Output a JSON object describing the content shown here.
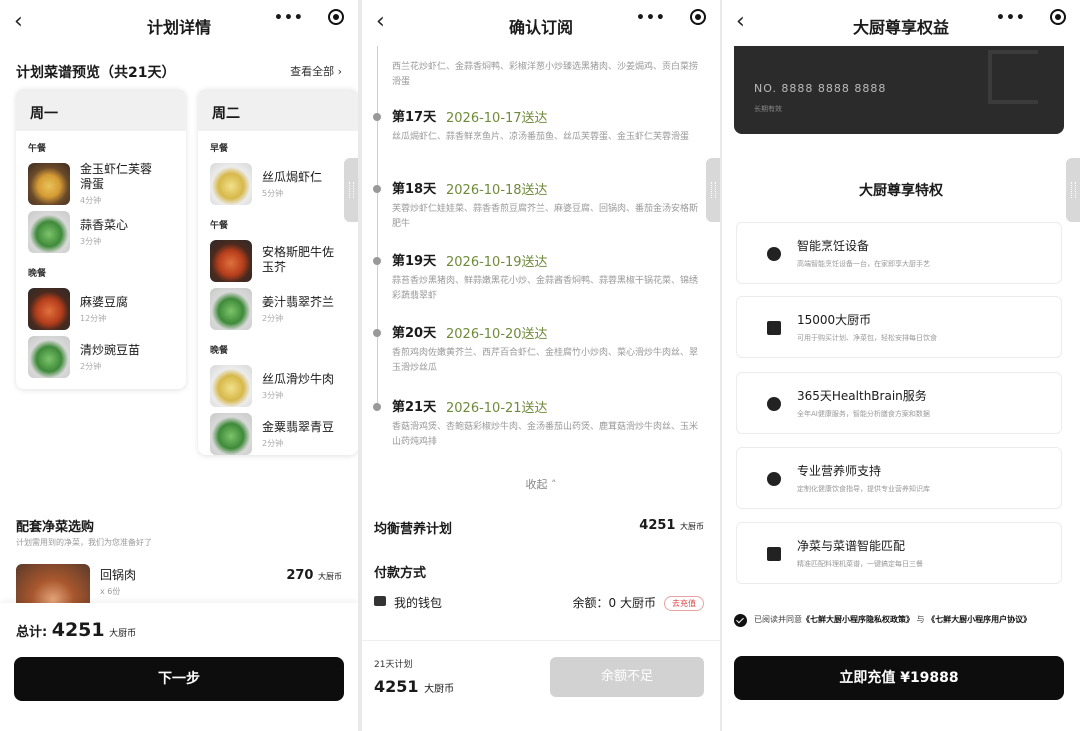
{
  "screen1": {
    "title": "计划详情",
    "section_title": "计划菜谱预览（共21天）",
    "see_all": "查看全部",
    "days": [
      {
        "name": "周一",
        "meals": [
          {
            "meal": "午餐",
            "dishes": [
              {
                "name": "金玉虾仁芙蓉\n滑蛋",
                "time": "4分钟"
              },
              {
                "name": "蒜香菜心",
                "time": "3分钟"
              }
            ]
          },
          {
            "meal": "晚餐",
            "dishes": [
              {
                "name": "麻婆豆腐",
                "time": "12分钟"
              },
              {
                "name": "清炒豌豆苗",
                "time": "2分钟"
              }
            ]
          }
        ]
      },
      {
        "name": "周二",
        "meals": [
          {
            "meal": "早餐",
            "dishes": [
              {
                "name": "丝瓜焗虾仁",
                "time": "5分钟"
              }
            ]
          },
          {
            "meal": "午餐",
            "dishes": [
              {
                "name": "安格斯肥牛佐\n玉芥",
                "time": ""
              },
              {
                "name": "姜汁翡翠芥兰",
                "time": "2分钟"
              }
            ]
          },
          {
            "meal": "晚餐",
            "dishes": [
              {
                "name": "丝瓜滑炒牛肉",
                "time": "3分钟"
              },
              {
                "name": "金粟翡翠青豆",
                "time": "2分钟"
              }
            ]
          }
        ]
      }
    ],
    "sub_title": "配套净菜选购",
    "sub_desc": "计划需用到的净菜，我们为您准备好了",
    "veg_item": {
      "name": "回锅肉",
      "qty": "x 6份",
      "price": "270",
      "unit": "大厨币"
    },
    "total_label": "总计:",
    "total_value": "4251",
    "total_unit": "大厨币",
    "next_button": "下一步"
  },
  "screen2": {
    "title": "确认订阅",
    "timeline": [
      {
        "day": "",
        "date": "",
        "menu": "西兰花炒虾仁、金蒜香焖鸭、彩椒洋葱小炒臻选黑猪肉、沙姜焗鸡、贡白菜捞滑蛋"
      },
      {
        "day": "第17天",
        "date": "2026-10-17送达",
        "menu": "丝瓜焗虾仁、蒜香鲜烹鱼片、凉汤番茄鱼、丝瓜芙蓉蛋、金玉虾仁芙蓉滑蛋"
      },
      {
        "day": "第18天",
        "date": "2026-10-18送达",
        "menu": "芙蓉炒虾仁娃娃菜、蒜香香煎豆腐芥兰、麻婆豆腐、回锅肉、番茄金汤安格斯肥牛"
      },
      {
        "day": "第19天",
        "date": "2026-10-19送达",
        "menu": "蒜苔香炒黑猪肉、鲜蒜嫩黑花小炒、金蒜酱香焖鸭、蒜蓉黑椒干锅花菜、锦绣彩蔬翡翠虾"
      },
      {
        "day": "第20天",
        "date": "2026-10-20送达",
        "menu": "香煎鸡肉佐嫩黄芥兰、西芹百合虾仁、金桂腐竹小炒肉、菜心滑炒牛肉丝、翠玉滑炒丝瓜"
      },
      {
        "day": "第21天",
        "date": "2026-10-21送达",
        "menu": "香菇滑鸡煲、杏鲍菇彩椒炒牛肉、金汤番茄山药煲、鹿茸菇滑炒牛肉丝、玉米山药炖鸡排"
      }
    ],
    "collapse": "收起",
    "plan_label": "均衡营养计划",
    "plan_price": "4251",
    "unit": "大厨币",
    "payment_label": "付款方式",
    "wallet_label": "我的钱包",
    "balance_label": "余额：",
    "balance_value": "0",
    "recharge_tag": "去充值",
    "footer_plan": "21天计划",
    "footer_price": "4251",
    "insufficient_button": "余额不足"
  },
  "screen3": {
    "title": "大厨尊享权益",
    "card_no": "NO. 8888 8888 8888",
    "card_validity": "长期有效",
    "privilege_title": "大厨尊享特权",
    "privileges": [
      {
        "title": "智能烹饪设备",
        "desc": "高端智能烹饪设备一台，在家即享大厨手艺",
        "icon": "pot-icon"
      },
      {
        "title": "15000大厨币",
        "desc": "可用于购买计划、净菜包，轻松安排每日饮食",
        "icon": "coin-icon"
      },
      {
        "title": "365天HealthBrain服务",
        "desc": "全年AI健康服务，智能分析膳食方案和数据",
        "icon": "chat-icon"
      },
      {
        "title": "专业营养师支持",
        "desc": "定制化健康饮食指导，提供专业营养知识库",
        "icon": "person-icon"
      },
      {
        "title": "净菜与菜谱智能匹配",
        "desc": "精准匹配料理机菜谱，一键搞定每日三餐",
        "icon": "building-icon"
      }
    ],
    "agree_prefix": "已阅读并同意",
    "policy_1": "《七鲜大厨小程序隐私权政策》",
    "agree_and": "与",
    "policy_2": "《七鲜大厨小程序用户协议》",
    "recharge_button": "立即充值 ¥19888"
  }
}
